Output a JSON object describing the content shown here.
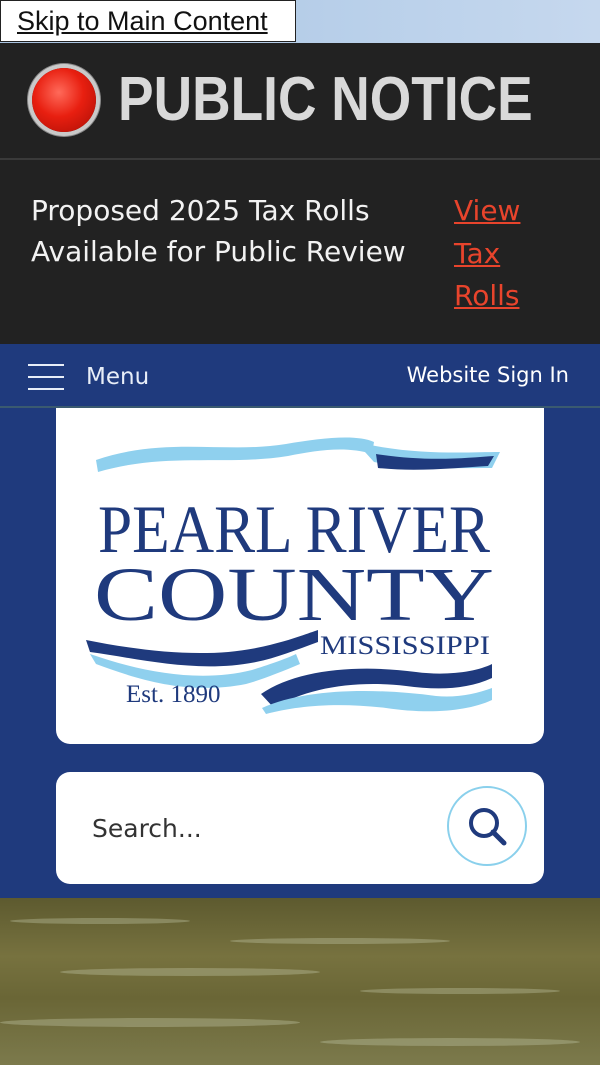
{
  "skip_link": "Skip to Main Content",
  "notice": {
    "title": "PUBLIC NOTICE",
    "message": "Proposed 2025 Tax Rolls Available for Public Review",
    "link_label": "View Tax Rolls"
  },
  "nav": {
    "menu_label": "Menu",
    "sign_in": "Website Sign In"
  },
  "logo": {
    "line1": "PEARL RIVER",
    "line2": "COUNTY",
    "state": "MISSISSIPPI",
    "established": "Est. 1890",
    "colors": {
      "navy": "#1f3a7d",
      "light_blue": "#8fd0ee"
    }
  },
  "search": {
    "placeholder": "Search...",
    "icon": "search-icon"
  },
  "colors": {
    "header_bg": "#222222",
    "nav_bg": "#1f3a7d",
    "link": "#e8442c"
  }
}
